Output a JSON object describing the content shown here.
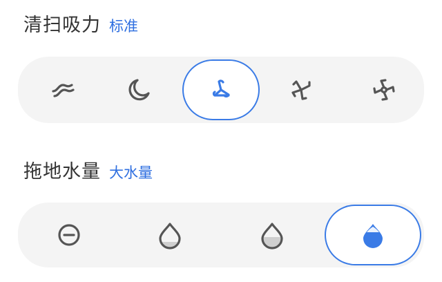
{
  "suction": {
    "title": "清扫吸力",
    "current": "标准",
    "options": [
      {
        "icon": "quiet-mode-icon",
        "selected": false
      },
      {
        "icon": "night-mode-icon",
        "selected": false
      },
      {
        "icon": "standard-fan-icon",
        "selected": true
      },
      {
        "icon": "strong-fan-icon",
        "selected": false
      },
      {
        "icon": "max-fan-icon",
        "selected": false
      }
    ]
  },
  "mop": {
    "title": "拖地水量",
    "current": "大水量",
    "options": [
      {
        "icon": "water-off-icon",
        "selected": false
      },
      {
        "icon": "water-low-icon",
        "selected": false
      },
      {
        "icon": "water-medium-icon",
        "selected": false
      },
      {
        "icon": "water-high-icon",
        "selected": true
      }
    ]
  },
  "colors": {
    "accent": "#2f6fe0",
    "icon_gray": "#555555",
    "pill_bg": "#f4f4f4"
  }
}
